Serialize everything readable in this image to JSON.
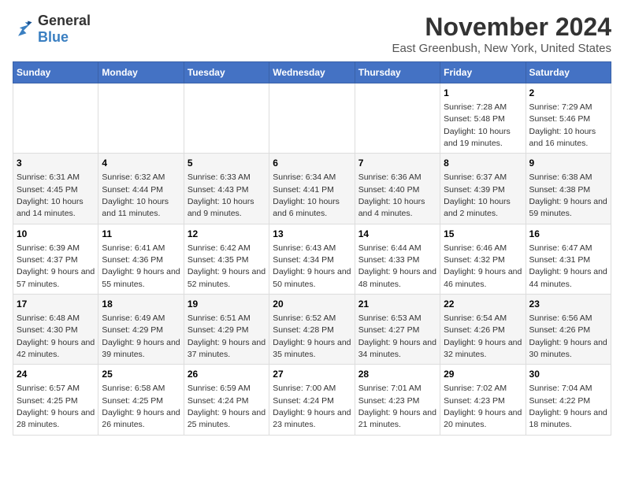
{
  "logo": {
    "general": "General",
    "blue": "Blue"
  },
  "title": "November 2024",
  "subtitle": "East Greenbush, New York, United States",
  "days_of_week": [
    "Sunday",
    "Monday",
    "Tuesday",
    "Wednesday",
    "Thursday",
    "Friday",
    "Saturday"
  ],
  "weeks": [
    [
      {
        "day": "",
        "info": ""
      },
      {
        "day": "",
        "info": ""
      },
      {
        "day": "",
        "info": ""
      },
      {
        "day": "",
        "info": ""
      },
      {
        "day": "",
        "info": ""
      },
      {
        "day": "1",
        "info": "Sunrise: 7:28 AM\nSunset: 5:48 PM\nDaylight: 10 hours and 19 minutes."
      },
      {
        "day": "2",
        "info": "Sunrise: 7:29 AM\nSunset: 5:46 PM\nDaylight: 10 hours and 16 minutes."
      }
    ],
    [
      {
        "day": "3",
        "info": "Sunrise: 6:31 AM\nSunset: 4:45 PM\nDaylight: 10 hours and 14 minutes."
      },
      {
        "day": "4",
        "info": "Sunrise: 6:32 AM\nSunset: 4:44 PM\nDaylight: 10 hours and 11 minutes."
      },
      {
        "day": "5",
        "info": "Sunrise: 6:33 AM\nSunset: 4:43 PM\nDaylight: 10 hours and 9 minutes."
      },
      {
        "day": "6",
        "info": "Sunrise: 6:34 AM\nSunset: 4:41 PM\nDaylight: 10 hours and 6 minutes."
      },
      {
        "day": "7",
        "info": "Sunrise: 6:36 AM\nSunset: 4:40 PM\nDaylight: 10 hours and 4 minutes."
      },
      {
        "day": "8",
        "info": "Sunrise: 6:37 AM\nSunset: 4:39 PM\nDaylight: 10 hours and 2 minutes."
      },
      {
        "day": "9",
        "info": "Sunrise: 6:38 AM\nSunset: 4:38 PM\nDaylight: 9 hours and 59 minutes."
      }
    ],
    [
      {
        "day": "10",
        "info": "Sunrise: 6:39 AM\nSunset: 4:37 PM\nDaylight: 9 hours and 57 minutes."
      },
      {
        "day": "11",
        "info": "Sunrise: 6:41 AM\nSunset: 4:36 PM\nDaylight: 9 hours and 55 minutes."
      },
      {
        "day": "12",
        "info": "Sunrise: 6:42 AM\nSunset: 4:35 PM\nDaylight: 9 hours and 52 minutes."
      },
      {
        "day": "13",
        "info": "Sunrise: 6:43 AM\nSunset: 4:34 PM\nDaylight: 9 hours and 50 minutes."
      },
      {
        "day": "14",
        "info": "Sunrise: 6:44 AM\nSunset: 4:33 PM\nDaylight: 9 hours and 48 minutes."
      },
      {
        "day": "15",
        "info": "Sunrise: 6:46 AM\nSunset: 4:32 PM\nDaylight: 9 hours and 46 minutes."
      },
      {
        "day": "16",
        "info": "Sunrise: 6:47 AM\nSunset: 4:31 PM\nDaylight: 9 hours and 44 minutes."
      }
    ],
    [
      {
        "day": "17",
        "info": "Sunrise: 6:48 AM\nSunset: 4:30 PM\nDaylight: 9 hours and 42 minutes."
      },
      {
        "day": "18",
        "info": "Sunrise: 6:49 AM\nSunset: 4:29 PM\nDaylight: 9 hours and 39 minutes."
      },
      {
        "day": "19",
        "info": "Sunrise: 6:51 AM\nSunset: 4:29 PM\nDaylight: 9 hours and 37 minutes."
      },
      {
        "day": "20",
        "info": "Sunrise: 6:52 AM\nSunset: 4:28 PM\nDaylight: 9 hours and 35 minutes."
      },
      {
        "day": "21",
        "info": "Sunrise: 6:53 AM\nSunset: 4:27 PM\nDaylight: 9 hours and 34 minutes."
      },
      {
        "day": "22",
        "info": "Sunrise: 6:54 AM\nSunset: 4:26 PM\nDaylight: 9 hours and 32 minutes."
      },
      {
        "day": "23",
        "info": "Sunrise: 6:56 AM\nSunset: 4:26 PM\nDaylight: 9 hours and 30 minutes."
      }
    ],
    [
      {
        "day": "24",
        "info": "Sunrise: 6:57 AM\nSunset: 4:25 PM\nDaylight: 9 hours and 28 minutes."
      },
      {
        "day": "25",
        "info": "Sunrise: 6:58 AM\nSunset: 4:25 PM\nDaylight: 9 hours and 26 minutes."
      },
      {
        "day": "26",
        "info": "Sunrise: 6:59 AM\nSunset: 4:24 PM\nDaylight: 9 hours and 25 minutes."
      },
      {
        "day": "27",
        "info": "Sunrise: 7:00 AM\nSunset: 4:24 PM\nDaylight: 9 hours and 23 minutes."
      },
      {
        "day": "28",
        "info": "Sunrise: 7:01 AM\nSunset: 4:23 PM\nDaylight: 9 hours and 21 minutes."
      },
      {
        "day": "29",
        "info": "Sunrise: 7:02 AM\nSunset: 4:23 PM\nDaylight: 9 hours and 20 minutes."
      },
      {
        "day": "30",
        "info": "Sunrise: 7:04 AM\nSunset: 4:22 PM\nDaylight: 9 hours and 18 minutes."
      }
    ]
  ]
}
